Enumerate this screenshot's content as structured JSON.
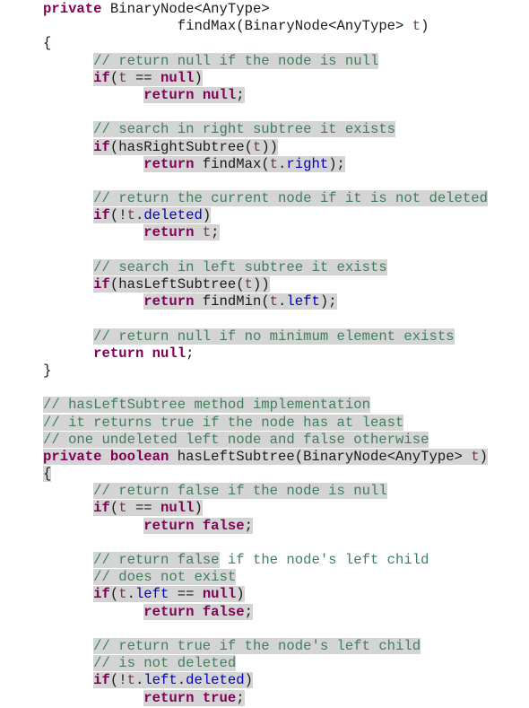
{
  "document": {
    "type": "java-code-snippet",
    "lines": [
      {
        "indent": "",
        "tokens": [
          {
            "t": "private",
            "c": "kw"
          },
          {
            "t": " BinaryNode<AnyType>",
            "c": ""
          }
        ],
        "hl": false
      },
      {
        "indent": "                ",
        "tokens": [
          {
            "t": "findMax(BinaryNode<AnyType> ",
            "c": ""
          },
          {
            "t": "t",
            "c": "var"
          },
          {
            "t": ")",
            "c": ""
          }
        ],
        "hl": false
      },
      {
        "indent": "",
        "tokens": [
          {
            "t": "{",
            "c": ""
          }
        ],
        "hl": false
      },
      {
        "indent": "      ",
        "tokens": [
          {
            "t": "// return null if the node is null",
            "c": "cm"
          }
        ],
        "hl": true
      },
      {
        "indent": "      ",
        "tokens": [
          {
            "t": "if",
            "c": "kw"
          },
          {
            "t": "(",
            "c": ""
          },
          {
            "t": "t",
            "c": "var"
          },
          {
            "t": " == ",
            "c": ""
          },
          {
            "t": "null",
            "c": "kw"
          },
          {
            "t": ")",
            "c": ""
          }
        ],
        "hl": true
      },
      {
        "indent": "            ",
        "tokens": [
          {
            "t": "return",
            "c": "kw"
          },
          {
            "t": " ",
            "c": ""
          },
          {
            "t": "null",
            "c": "kw"
          },
          {
            "t": ";",
            "c": ""
          }
        ],
        "hl": true
      },
      {
        "indent": "",
        "tokens": [],
        "hl": false
      },
      {
        "indent": "      ",
        "tokens": [
          {
            "t": "// search in right subtree it exists",
            "c": "cm"
          }
        ],
        "hl": true
      },
      {
        "indent": "      ",
        "tokens": [
          {
            "t": "if",
            "c": "kw"
          },
          {
            "t": "(hasRightSubtree(",
            "c": ""
          },
          {
            "t": "t",
            "c": "var"
          },
          {
            "t": "))",
            "c": ""
          }
        ],
        "hl": true
      },
      {
        "indent": "            ",
        "tokens": [
          {
            "t": "return",
            "c": "kw"
          },
          {
            "t": " findMax(",
            "c": ""
          },
          {
            "t": "t",
            "c": "var"
          },
          {
            "t": ".",
            "c": ""
          },
          {
            "t": "right",
            "c": "fld"
          },
          {
            "t": ");",
            "c": ""
          }
        ],
        "hl": true
      },
      {
        "indent": "",
        "tokens": [],
        "hl": false
      },
      {
        "indent": "      ",
        "tokens": [
          {
            "t": "// return the current node if it is not deleted",
            "c": "cm"
          }
        ],
        "hl": true
      },
      {
        "indent": "      ",
        "tokens": [
          {
            "t": "if",
            "c": "kw"
          },
          {
            "t": "(!",
            "c": ""
          },
          {
            "t": "t",
            "c": "var"
          },
          {
            "t": ".",
            "c": ""
          },
          {
            "t": "deleted",
            "c": "fld"
          },
          {
            "t": ")",
            "c": ""
          }
        ],
        "hl": true
      },
      {
        "indent": "            ",
        "tokens": [
          {
            "t": "return",
            "c": "kw"
          },
          {
            "t": " ",
            "c": ""
          },
          {
            "t": "t",
            "c": "var"
          },
          {
            "t": ";",
            "c": ""
          }
        ],
        "hl": true
      },
      {
        "indent": "",
        "tokens": [],
        "hl": false
      },
      {
        "indent": "      ",
        "tokens": [
          {
            "t": "// search in left subtree it exists",
            "c": "cm"
          }
        ],
        "hl": true
      },
      {
        "indent": "      ",
        "tokens": [
          {
            "t": "if",
            "c": "kw"
          },
          {
            "t": "(hasLeftSubtree(",
            "c": ""
          },
          {
            "t": "t",
            "c": "var"
          },
          {
            "t": "))",
            "c": ""
          }
        ],
        "hl": true
      },
      {
        "indent": "            ",
        "tokens": [
          {
            "t": "return",
            "c": "kw"
          },
          {
            "t": " findMin(",
            "c": ""
          },
          {
            "t": "t",
            "c": "var"
          },
          {
            "t": ".",
            "c": ""
          },
          {
            "t": "left",
            "c": "fld"
          },
          {
            "t": ");",
            "c": ""
          }
        ],
        "hl": true
      },
      {
        "indent": "",
        "tokens": [],
        "hl": false
      },
      {
        "indent": "      ",
        "tokens": [
          {
            "t": "// return null if no minimum element exists",
            "c": "cm"
          }
        ],
        "hl": true
      },
      {
        "indent": "      ",
        "tokens": [
          {
            "t": "return",
            "c": "kw"
          },
          {
            "t": " ",
            "c": ""
          },
          {
            "t": "null",
            "c": "kw"
          },
          {
            "t": ";",
            "c": ""
          }
        ],
        "hl": false
      },
      {
        "indent": "",
        "tokens": [
          {
            "t": "}",
            "c": ""
          }
        ],
        "hl": false
      },
      {
        "indent": "",
        "tokens": [],
        "hl": false
      },
      {
        "indent": "",
        "tokens": [
          {
            "t": "// hasLeftSubtree method implementation",
            "c": "cm"
          }
        ],
        "hl": true
      },
      {
        "indent": "",
        "tokens": [
          {
            "t": "// it returns true if the node has at least",
            "c": "cm"
          }
        ],
        "hl": true
      },
      {
        "indent": "",
        "tokens": [
          {
            "t": "// one undeleted left node and false otherwise",
            "c": "cm"
          }
        ],
        "hl": true
      },
      {
        "indent": "",
        "tokens": [
          {
            "t": "private",
            "c": "kw"
          },
          {
            "t": " ",
            "c": ""
          },
          {
            "t": "boolean",
            "c": "kw"
          },
          {
            "t": " hasLeftSubtree(BinaryNode<AnyType> ",
            "c": ""
          },
          {
            "t": "t",
            "c": "var"
          },
          {
            "t": ")",
            "c": ""
          }
        ],
        "hl": true
      },
      {
        "indent": "",
        "tokens": [
          {
            "t": "{",
            "c": ""
          }
        ],
        "hl": true
      },
      {
        "indent": "      ",
        "tokens": [
          {
            "t": "// return false if the node is null",
            "c": "cm"
          }
        ],
        "hl": true
      },
      {
        "indent": "      ",
        "tokens": [
          {
            "t": "if",
            "c": "kw"
          },
          {
            "t": "(",
            "c": ""
          },
          {
            "t": "t",
            "c": "var"
          },
          {
            "t": " == ",
            "c": ""
          },
          {
            "t": "null",
            "c": "kw"
          },
          {
            "t": ")",
            "c": ""
          }
        ],
        "hl": true
      },
      {
        "indent": "            ",
        "tokens": [
          {
            "t": "return",
            "c": "kw"
          },
          {
            "t": " ",
            "c": ""
          },
          {
            "t": "false",
            "c": "kw"
          },
          {
            "t": ";",
            "c": ""
          }
        ],
        "hl": true
      },
      {
        "indent": "",
        "tokens": [],
        "hl": false
      },
      {
        "indent": "      ",
        "tokens": [
          {
            "t": "// return false",
            "c": "cm",
            "hl": true
          },
          {
            "t": " if the node's left child",
            "c": "cm",
            "hl": false
          }
        ],
        "hl": "partial"
      },
      {
        "indent": "      ",
        "tokens": [
          {
            "t": "// does not exist",
            "c": "cm"
          }
        ],
        "hl": true
      },
      {
        "indent": "      ",
        "tokens": [
          {
            "t": "if",
            "c": "kw"
          },
          {
            "t": "(",
            "c": ""
          },
          {
            "t": "t",
            "c": "var"
          },
          {
            "t": ".",
            "c": ""
          },
          {
            "t": "left",
            "c": "fld"
          },
          {
            "t": " == ",
            "c": ""
          },
          {
            "t": "null",
            "c": "kw"
          },
          {
            "t": ")",
            "c": ""
          }
        ],
        "hl": true
      },
      {
        "indent": "            ",
        "tokens": [
          {
            "t": "return",
            "c": "kw"
          },
          {
            "t": " ",
            "c": ""
          },
          {
            "t": "false",
            "c": "kw"
          },
          {
            "t": ";",
            "c": ""
          }
        ],
        "hl": true
      },
      {
        "indent": "",
        "tokens": [],
        "hl": false
      },
      {
        "indent": "      ",
        "tokens": [
          {
            "t": "// return true if the node's left child",
            "c": "cm"
          }
        ],
        "hl": true
      },
      {
        "indent": "      ",
        "tokens": [
          {
            "t": "// is not deleted",
            "c": "cm"
          }
        ],
        "hl": true
      },
      {
        "indent": "      ",
        "tokens": [
          {
            "t": "if",
            "c": "kw"
          },
          {
            "t": "(!",
            "c": ""
          },
          {
            "t": "t",
            "c": "var"
          },
          {
            "t": ".",
            "c": ""
          },
          {
            "t": "left",
            "c": "fld"
          },
          {
            "t": ".",
            "c": ""
          },
          {
            "t": "deleted",
            "c": "fld"
          },
          {
            "t": ")",
            "c": ""
          }
        ],
        "hl": true
      },
      {
        "indent": "            ",
        "tokens": [
          {
            "t": "return",
            "c": "kw"
          },
          {
            "t": " ",
            "c": ""
          },
          {
            "t": "true",
            "c": "kw"
          },
          {
            "t": ";",
            "c": ""
          }
        ],
        "hl": true
      }
    ]
  },
  "colors": {
    "keyword": "#7f0055",
    "comment": "#3f7f5f",
    "variable": "#6a3e3e",
    "field": "#0000c0",
    "highlight": "#d4d4d4"
  }
}
